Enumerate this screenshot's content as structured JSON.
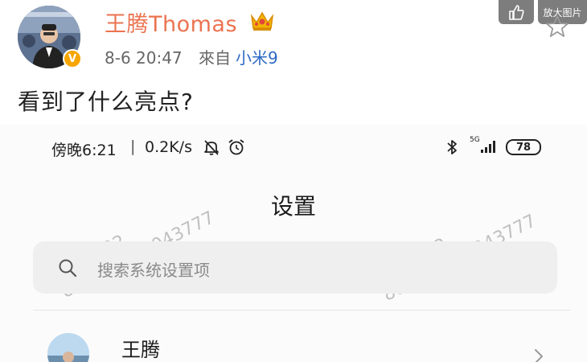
{
  "post": {
    "username": "王腾Thomas",
    "timestamp": "8-6 20:47",
    "source_prefix": "來自",
    "source": "小米9",
    "text": "看到了什么亮点?",
    "verified_badge": "V"
  },
  "image_toolbar": {
    "zoom_label": "放大图片"
  },
  "phone_screen": {
    "status_bar": {
      "time": "傍晚6:21",
      "separator": "|",
      "net_speed": "0.2K/s",
      "network_label": "5G",
      "battery": "78"
    },
    "page_title": "设置",
    "search": {
      "placeholder": "搜索系统设置项"
    },
    "account": {
      "name": "王腾"
    },
    "watermark": {
      "line1": "2342102",
      "line2": "860204040043777"
    }
  },
  "colors": {
    "username": "#eb7350",
    "source_link": "#2d6bc4",
    "verified_badge": "#f7a600"
  }
}
